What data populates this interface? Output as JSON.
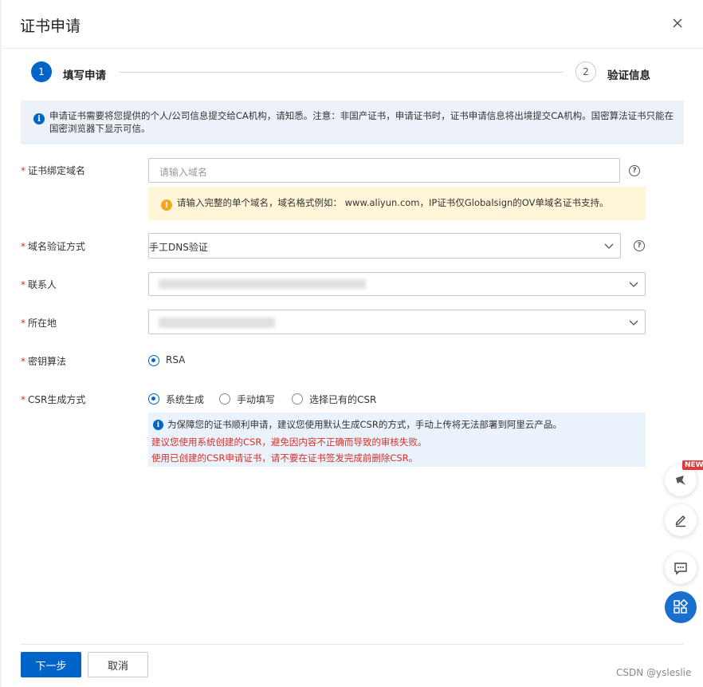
{
  "dialog": {
    "title": "证书申请"
  },
  "steps": [
    {
      "number": "1",
      "label": "填写申请"
    },
    {
      "number": "2",
      "label": "验证信息"
    }
  ],
  "notice": {
    "text": "申请证书需要将您提供的个人/公司信息提交给CA机构，请知悉。注意：非国产证书，申请证书时，证书申请信息将出境提交CA机构。国密算法证书只能在国密浏览器下显示可信。"
  },
  "form": {
    "domain": {
      "label": "证书绑定域名",
      "placeholder": "请输入域名",
      "warning": "请输入完整的单个域名，域名格式例如： www.aliyun.com，IP证书仅Globalsign的OV单域名证书支持。"
    },
    "verify_method": {
      "label": "域名验证方式",
      "value": "手工DNS验证"
    },
    "contact": {
      "label": "联系人"
    },
    "location": {
      "label": "所在地"
    },
    "key_algorithm": {
      "label": "密钥算法",
      "options": [
        "RSA"
      ],
      "selected": "RSA"
    },
    "csr_method": {
      "label": "CSR生成方式",
      "options": [
        "系统生成",
        "手动填写",
        "选择已有的CSR"
      ],
      "selected": "系统生成",
      "info_line1": "为保障您的证书顺利申请，建议您使用默认生成CSR的方式，手动上传将无法部署到阿里云产品。",
      "info_line2": "建议您使用系统创建的CSR，避免因内容不正确而导致的审核失败。",
      "info_line3": "使用已创建的CSR申请证书，请不要在证书签发完成前删除CSR。"
    },
    "required_mark": "*"
  },
  "floating": {
    "new_badge": "NEW"
  },
  "footer": {
    "next_label": "下一步",
    "cancel_label": "取消"
  },
  "watermark": "CSDN @ysleslie",
  "colors": {
    "primary": "#0064c8",
    "error": "#d93026",
    "warning_bg": "#fff6d9",
    "info_bg": "#eaf2fb"
  }
}
